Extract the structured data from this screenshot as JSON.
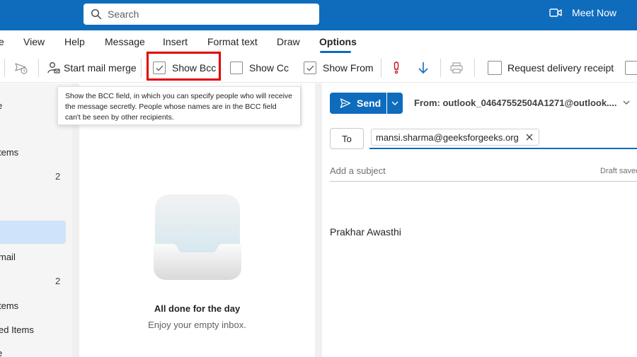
{
  "header": {
    "search_placeholder": "Search",
    "meet_now_label": "Meet Now",
    "accent": "#0f6cbd"
  },
  "tabs": [
    {
      "label": "e"
    },
    {
      "label": "View"
    },
    {
      "label": "Help"
    },
    {
      "label": "Message"
    },
    {
      "label": "Insert"
    },
    {
      "label": "Format text"
    },
    {
      "label": "Draw"
    },
    {
      "label": "Options",
      "active": true
    }
  ],
  "ribbon": {
    "start_mail_merge": "Start mail merge",
    "show_bcc": "Show Bcc",
    "show_cc": "Show Cc",
    "show_from": "Show From",
    "request_delivery_receipt": "Request delivery receipt",
    "checked": {
      "show_bcc": true,
      "show_cc": false,
      "show_from": true,
      "request_delivery_receipt": false
    },
    "highlight_color": "#e00000"
  },
  "tooltip": {
    "text": "Show the BCC field, in which you can specify people who will receive the message secretly. People whose names are in the BCC field can't be seen by other recipients."
  },
  "left_nav": {
    "items": [
      {
        "label": "e"
      },
      {
        "label": "tems"
      },
      {
        "label": "mail"
      },
      {
        "label": "tems"
      },
      {
        "label": "ed Items"
      },
      {
        "label": "e"
      }
    ],
    "counts": [
      "2",
      "2"
    ]
  },
  "message_list": {
    "empty_title": "All done for the day",
    "empty_subtitle": "Enjoy your empty inbox."
  },
  "compose": {
    "send_label": "Send",
    "from_text": "From: outlook_04647552504A1271@outlook....",
    "to_label": "To",
    "to_recipient": "mansi.sharma@geeksforgeeks.org",
    "subject_placeholder": "Add a subject",
    "draft_status": "Draft saved",
    "signature": "Prakhar Awasthi"
  }
}
